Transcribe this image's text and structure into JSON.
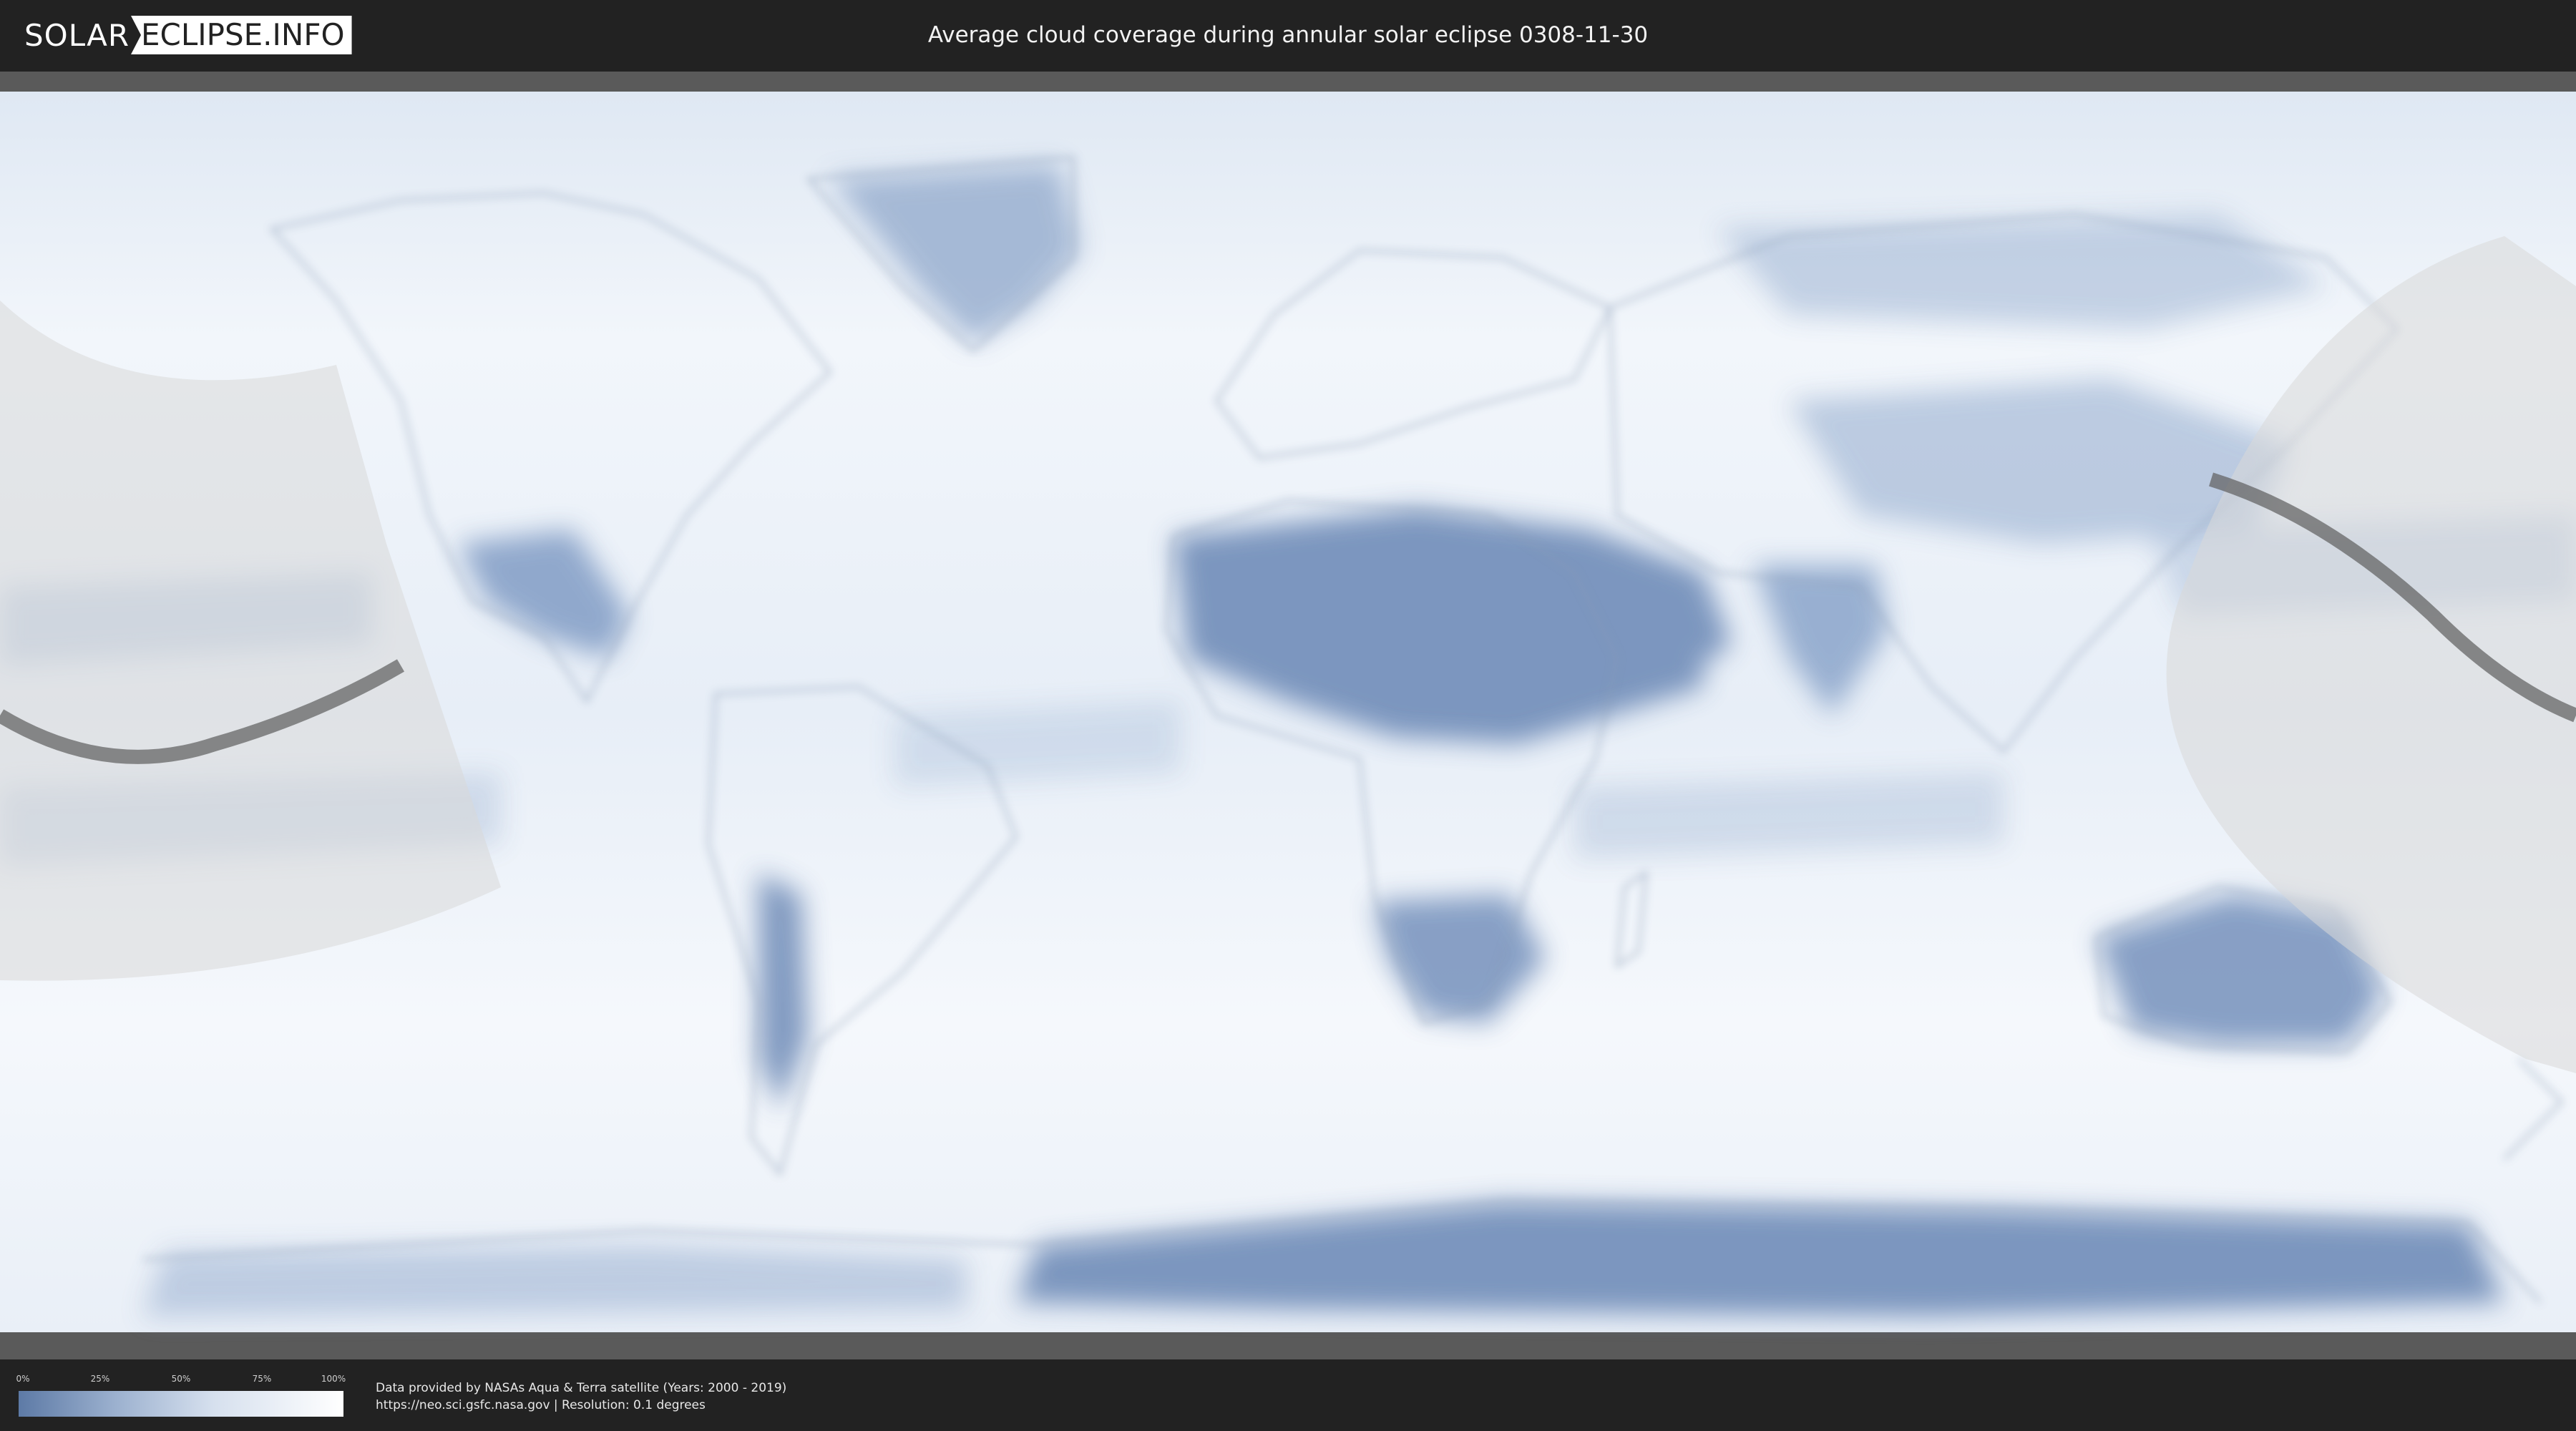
{
  "header": {
    "logo_left": "SOLAR",
    "logo_right": "ECLIPSE.INFO",
    "title": "Average cloud coverage during annular solar eclipse 0308-11-30"
  },
  "map": {
    "background_color": "#eef3f9",
    "cloud_color_low": "#5d7aa6",
    "cloud_color_high": "#ffffff",
    "overlay_color": "#d8d8d8",
    "path_color": "#555555",
    "eclipse_type": "annular"
  },
  "legend": {
    "ticks": [
      "0%",
      "25%",
      "50%",
      "75%",
      "100%"
    ]
  },
  "credits": {
    "line1": "Data provided by NASAs Aqua & Terra satellite (Years: 2000 - 2019)",
    "line2": "https://neo.sci.gsfc.nasa.gov | Resolution: 0.1 degrees"
  }
}
